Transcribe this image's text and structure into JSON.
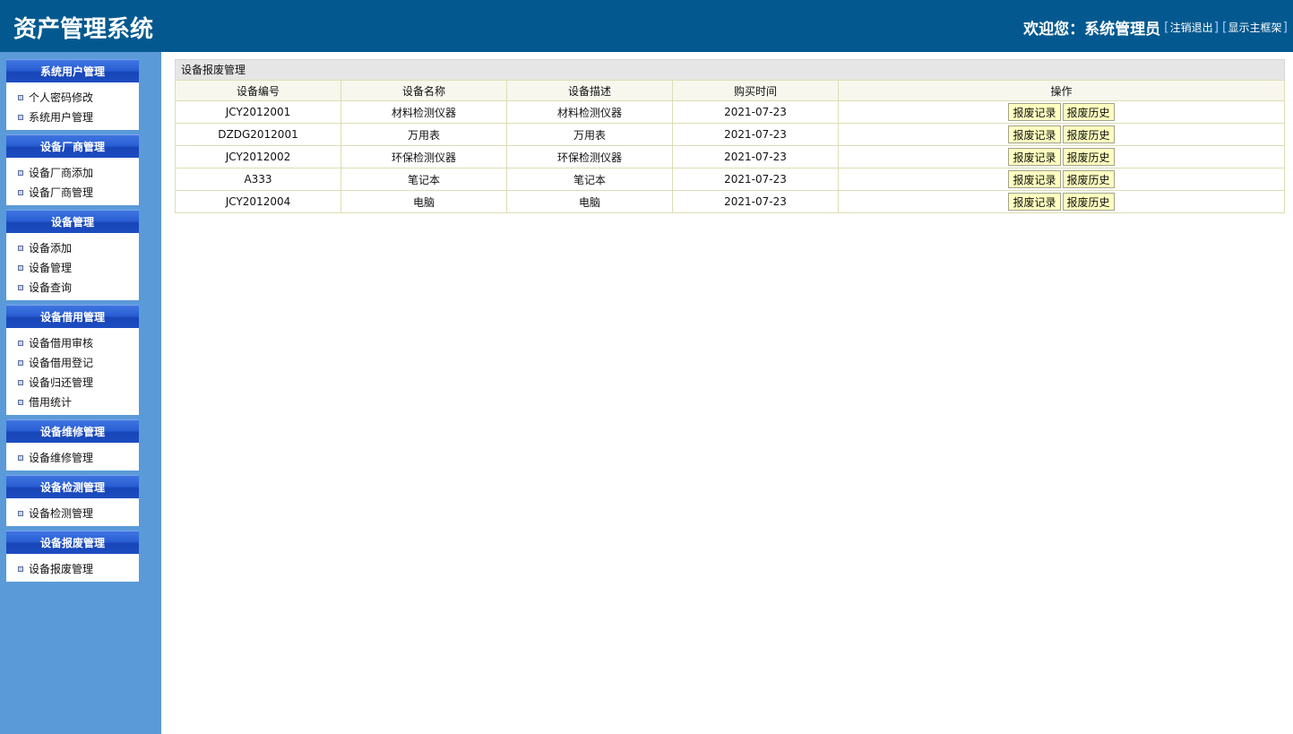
{
  "header": {
    "app_title": "资产管理系统",
    "welcome_label": "欢迎您：",
    "user_name": "系统管理员",
    "logout_link": "注销退出",
    "show_frame_link": "显示主框架",
    "bracket_open": "[",
    "bracket_close": "]"
  },
  "sidebar": {
    "groups": [
      {
        "title": "系统用户管理",
        "items": [
          "个人密码修改",
          "系统用户管理"
        ]
      },
      {
        "title": "设备厂商管理",
        "items": [
          "设备厂商添加",
          "设备厂商管理"
        ]
      },
      {
        "title": "设备管理",
        "items": [
          "设备添加",
          "设备管理",
          "设备查询"
        ]
      },
      {
        "title": "设备借用管理",
        "items": [
          "设备借用审核",
          "设备借用登记",
          "设备归还管理",
          "借用统计"
        ]
      },
      {
        "title": "设备维修管理",
        "items": [
          "设备维修管理"
        ]
      },
      {
        "title": "设备检测管理",
        "items": [
          "设备检测管理"
        ]
      },
      {
        "title": "设备报废管理",
        "items": [
          "设备报废管理"
        ]
      }
    ]
  },
  "main": {
    "panel_title": "设备报废管理",
    "columns": [
      "设备编号",
      "设备名称",
      "设备描述",
      "购买时间",
      "操作"
    ],
    "rows": [
      [
        "JCY2012001",
        "材料检测仪器",
        "材料检测仪器",
        "2021-07-23"
      ],
      [
        "DZDG2012001",
        "万用表",
        "万用表",
        "2021-07-23"
      ],
      [
        "JCY2012002",
        "环保检测仪器",
        "环保检测仪器",
        "2021-07-23"
      ],
      [
        "A333",
        "笔记本",
        "笔记本",
        "2021-07-23"
      ],
      [
        "JCY2012004",
        "电脑",
        "电脑",
        "2021-07-23"
      ]
    ],
    "actions": [
      "报废记录",
      "报废历史"
    ]
  }
}
